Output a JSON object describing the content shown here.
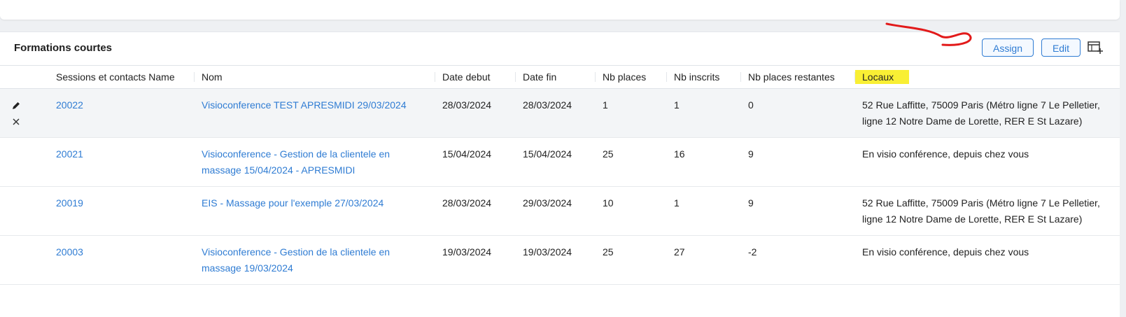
{
  "panel": {
    "title": "Formations courtes",
    "assign_label": "Assign",
    "edit_label": "Edit",
    "manage_columns_icon": "table-add-column-icon"
  },
  "colors": {
    "accent": "#2f7cd3",
    "highlight": "#f9ef34",
    "annotation": "#e21a1a"
  },
  "table": {
    "columns": [
      "Sessions et contacts Name",
      "Nom",
      "Date debut",
      "Date fin",
      "Nb places",
      "Nb inscrits",
      "Nb places restantes",
      "Locaux"
    ],
    "rows": [
      {
        "id": "20022",
        "nom": "Visioconference TEST APRESMIDI 29/03/2024",
        "date_debut": "28/03/2024",
        "date_fin": "28/03/2024",
        "nb_places": "1",
        "nb_inscrits": "1",
        "nb_restantes": "0",
        "locaux": "52 Rue Laffitte, 75009 Paris (Métro ligne 7 Le Pelletier, ligne 12 Notre Dame de Lorette, RER E St Lazare)"
      },
      {
        "id": "20021",
        "nom": "Visioconference - Gestion de la clientele en massage 15/04/2024 - APRESMIDI",
        "date_debut": "15/04/2024",
        "date_fin": "15/04/2024",
        "nb_places": "25",
        "nb_inscrits": "16",
        "nb_restantes": "9",
        "locaux": "En visio conférence, depuis chez vous"
      },
      {
        "id": "20019",
        "nom": "EIS - Massage pour l'exemple 27/03/2024",
        "date_debut": "28/03/2024",
        "date_fin": "29/03/2024",
        "nb_places": "10",
        "nb_inscrits": "1",
        "nb_restantes": "9",
        "locaux": "52 Rue Laffitte, 75009 Paris (Métro ligne 7 Le Pelletier, ligne 12 Notre Dame de Lorette, RER E St Lazare)"
      },
      {
        "id": "20003",
        "nom": "Visioconference - Gestion de la clientele en massage 19/03/2024",
        "date_debut": "19/03/2024",
        "date_fin": "19/03/2024",
        "nb_places": "25",
        "nb_inscrits": "27",
        "nb_restantes": "-2",
        "locaux": "En visio conférence, depuis chez vous"
      }
    ]
  }
}
